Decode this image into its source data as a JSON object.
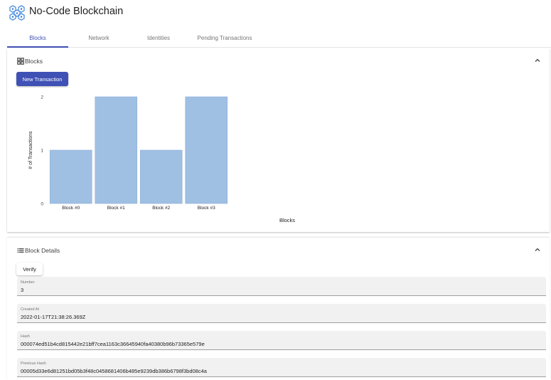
{
  "app": {
    "title": "No-Code Blockchain",
    "logo_icon": "blockchain-network-icon",
    "accent_color": "#3f51b5"
  },
  "tabs": [
    {
      "label": "Blocks",
      "active": true
    },
    {
      "label": "Network",
      "active": false
    },
    {
      "label": "Identities",
      "active": false
    },
    {
      "label": "Pending Transactions",
      "active": false
    }
  ],
  "blocks_section": {
    "title": "Blocks",
    "icon": "grid-view-icon",
    "collapse_icon": "chevron-up-icon",
    "new_transaction_label": "New Transaction"
  },
  "chart_data": {
    "type": "bar",
    "categories": [
      "Block #0",
      "Block #1",
      "Block #2",
      "Block #3"
    ],
    "values": [
      1,
      2,
      1,
      2
    ],
    "xlabel": "Blocks",
    "ylabel": "# of Transactions",
    "ylim": [
      0,
      2
    ],
    "yticks": [
      0,
      1,
      2
    ],
    "bar_color": "#9fbfe3",
    "grid": false
  },
  "details_section": {
    "title": "Block Details",
    "icon": "list-icon",
    "collapse_icon": "chevron-up-icon",
    "verify_label": "Verify",
    "fields": [
      {
        "label": "Number",
        "value": "3"
      },
      {
        "label": "Created At",
        "value": "2022-01-17T21:38:26.369Z"
      },
      {
        "label": "Hash",
        "value": "000074ed51b4cd815442e21bff7cea1163c36645940fa40380b96b73365e579e"
      },
      {
        "label": "Previous Hash",
        "value": "00005d33e6d81251bd05b3f48c0458681406b485e9239db386b6798f3bd08c4a"
      }
    ]
  }
}
